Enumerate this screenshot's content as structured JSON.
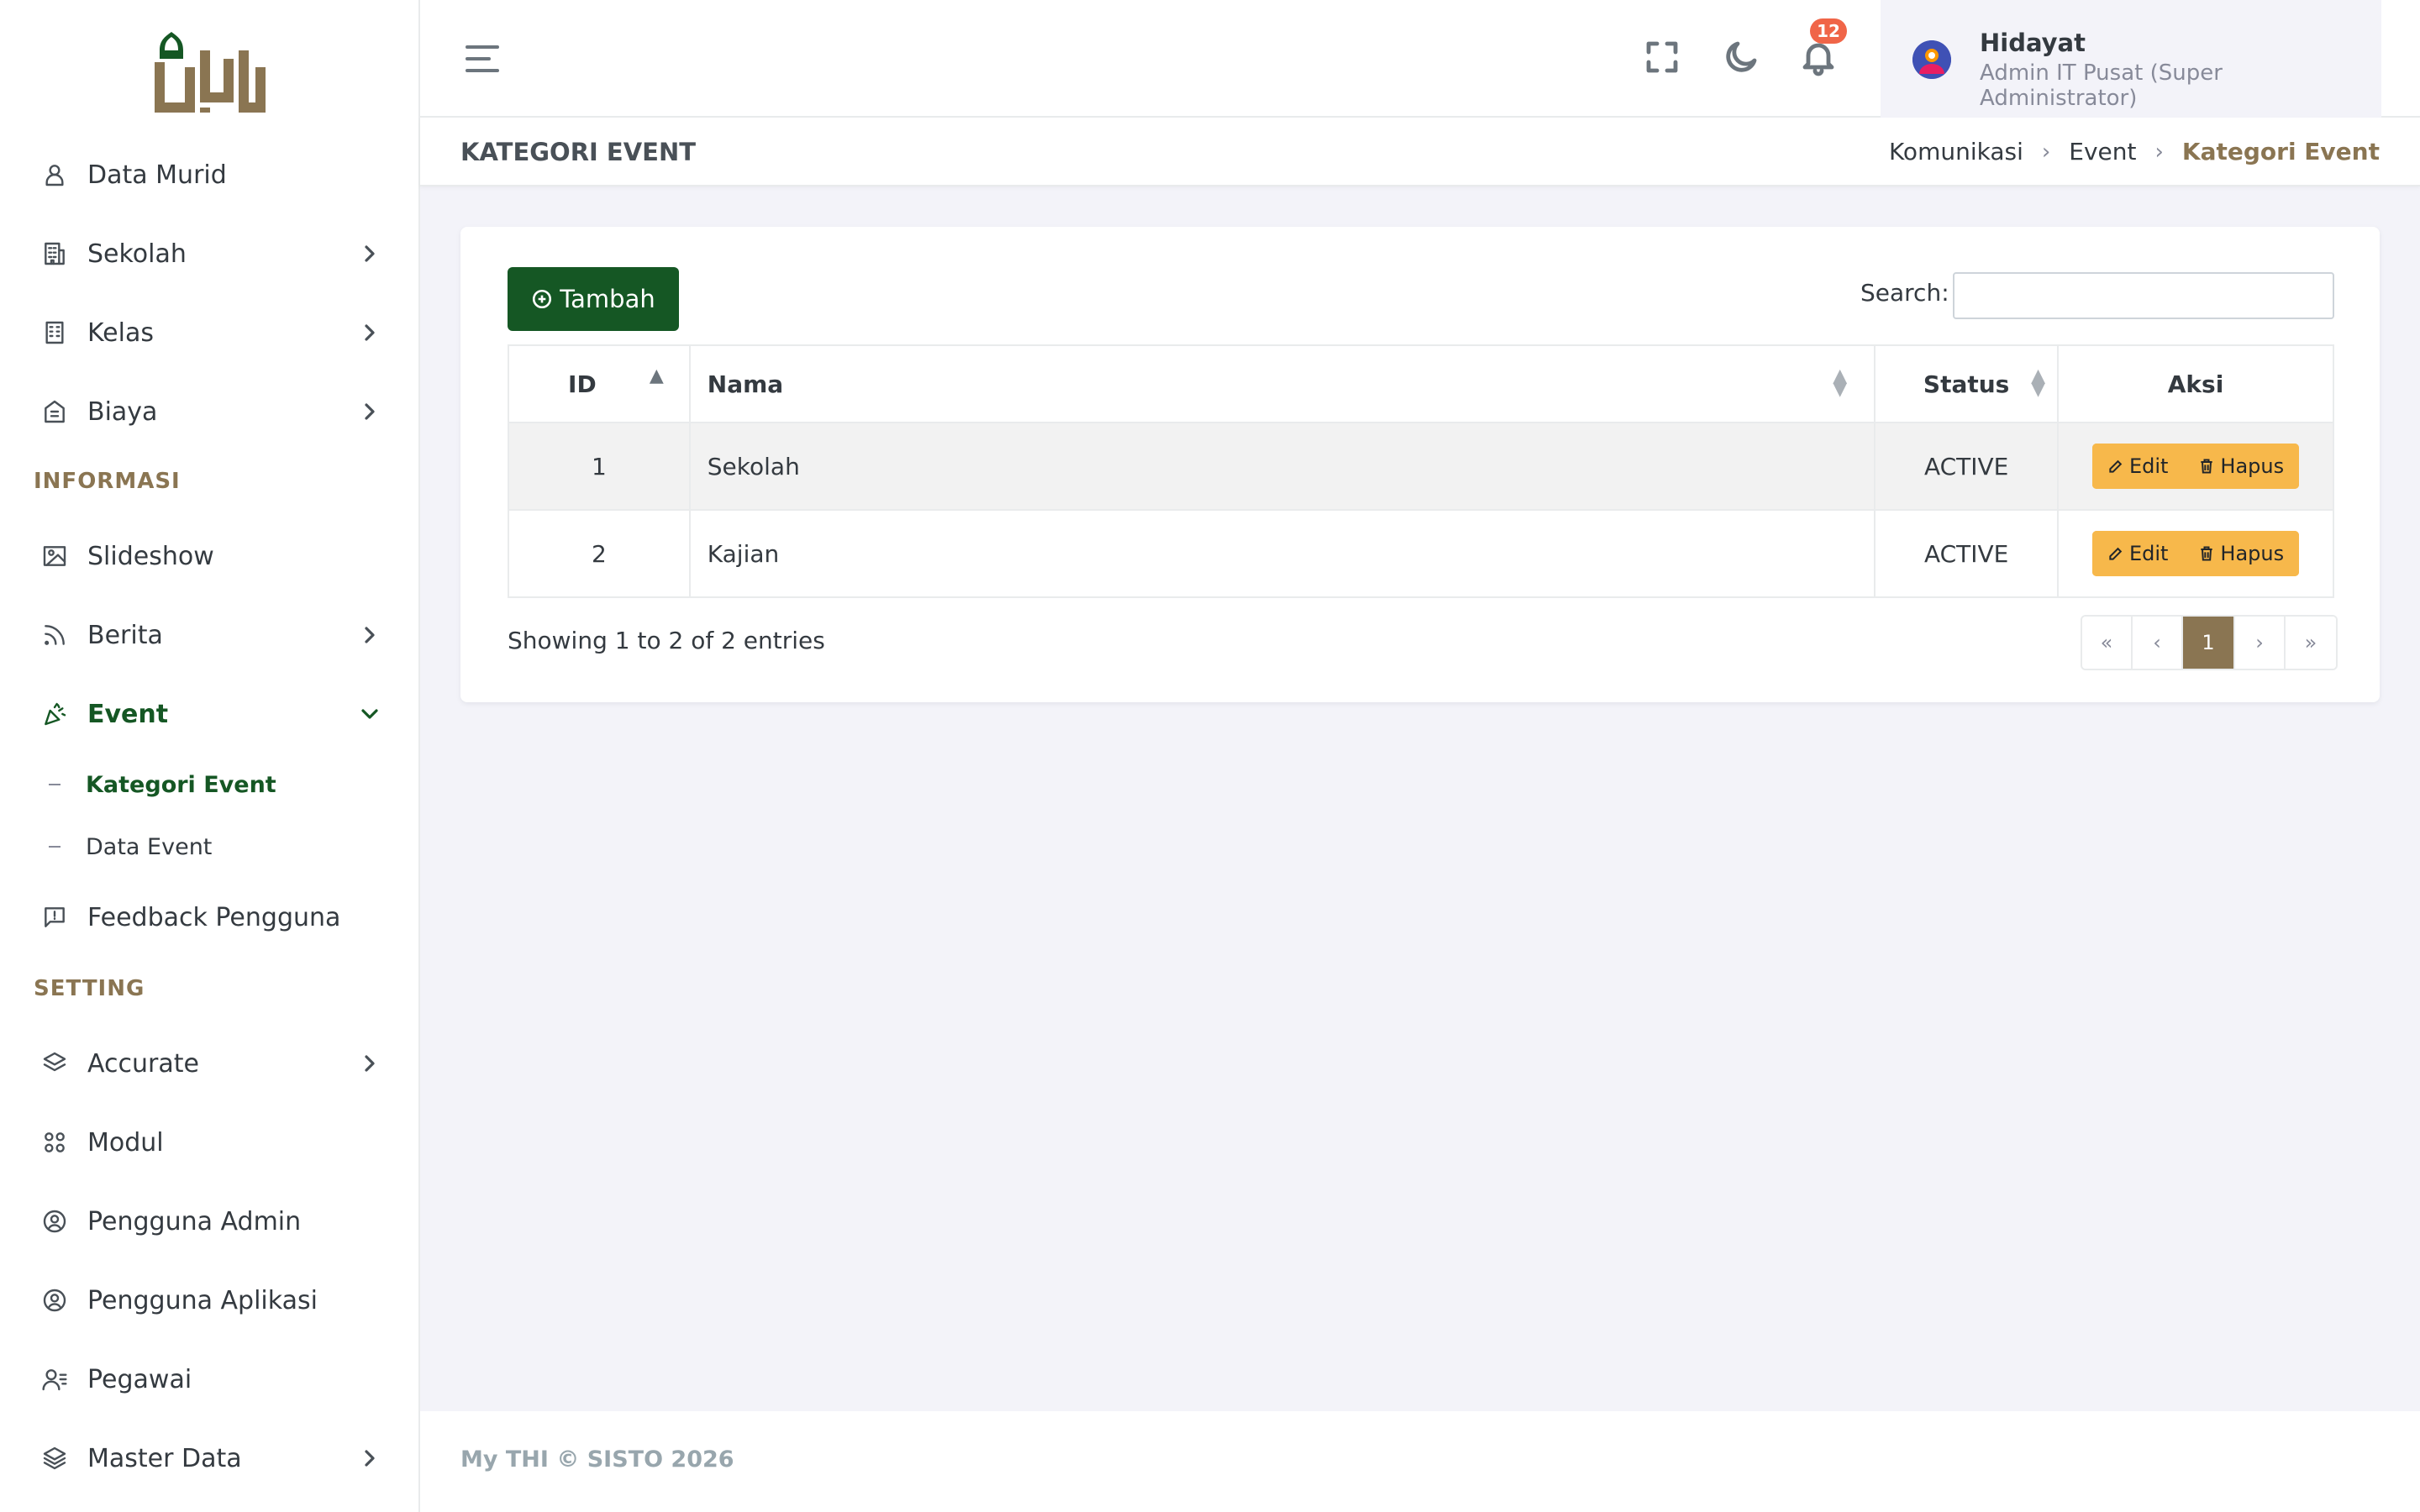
{
  "brand": {
    "logo_icon": "arabic-calligraphy-logo"
  },
  "sidebar": {
    "items": [
      {
        "label": "Data Murid",
        "icon": "user-icon"
      },
      {
        "label": "Sekolah",
        "icon": "building-icon"
      },
      {
        "label": "Kelas",
        "icon": "classroom-icon"
      },
      {
        "label": "Biaya",
        "icon": "invoice-icon"
      },
      {
        "label": "Slideshow",
        "icon": "image-icon"
      },
      {
        "label": "Berita",
        "icon": "rss-icon"
      },
      {
        "label": "Event",
        "icon": "party-icon"
      },
      {
        "label": "Feedback Pengguna",
        "icon": "feedback-icon"
      },
      {
        "label": "Accurate",
        "icon": "layers-icon"
      },
      {
        "label": "Modul",
        "icon": "apps-icon"
      },
      {
        "label": "Pengguna Admin",
        "icon": "user-circle-icon"
      },
      {
        "label": "Pengguna Aplikasi",
        "icon": "user-circle-icon"
      },
      {
        "label": "Pegawai",
        "icon": "user-list-icon"
      },
      {
        "label": "Master Data",
        "icon": "stack-icon"
      }
    ],
    "sections": {
      "informasi": "INFORMASI",
      "setting": "SETTING"
    },
    "event_sub": [
      "Kategori Event",
      "Data Event"
    ]
  },
  "header": {
    "notification_count": "12",
    "user_name": "Hidayat",
    "user_role": "Admin IT Pusat (Super Administrator)"
  },
  "page": {
    "title": "KATEGORI EVENT",
    "breadcrumb": [
      "Komunikasi",
      "Event",
      "Kategori Event"
    ]
  },
  "toolbar": {
    "add_label": "Tambah",
    "search_label": "Search:",
    "search_value": ""
  },
  "table": {
    "columns": [
      "ID",
      "Nama",
      "Status",
      "Aksi"
    ],
    "rows": [
      {
        "id": "1",
        "nama": "Sekolah",
        "status": "ACTIVE"
      },
      {
        "id": "2",
        "nama": "Kajian",
        "status": "ACTIVE"
      }
    ],
    "edit_label": "Edit",
    "delete_label": "Hapus"
  },
  "pagination": {
    "info": "Showing 1 to 2 of 2 entries",
    "first": "«",
    "prev": "‹",
    "current": "1",
    "next": "›",
    "last": "»"
  },
  "footer": {
    "text": "My THI © SISTO 2026"
  },
  "colors": {
    "primary_green": "#155724",
    "accent_gold": "#8a7552",
    "warning": "#f7b84b",
    "badge_red": "#f06548"
  }
}
